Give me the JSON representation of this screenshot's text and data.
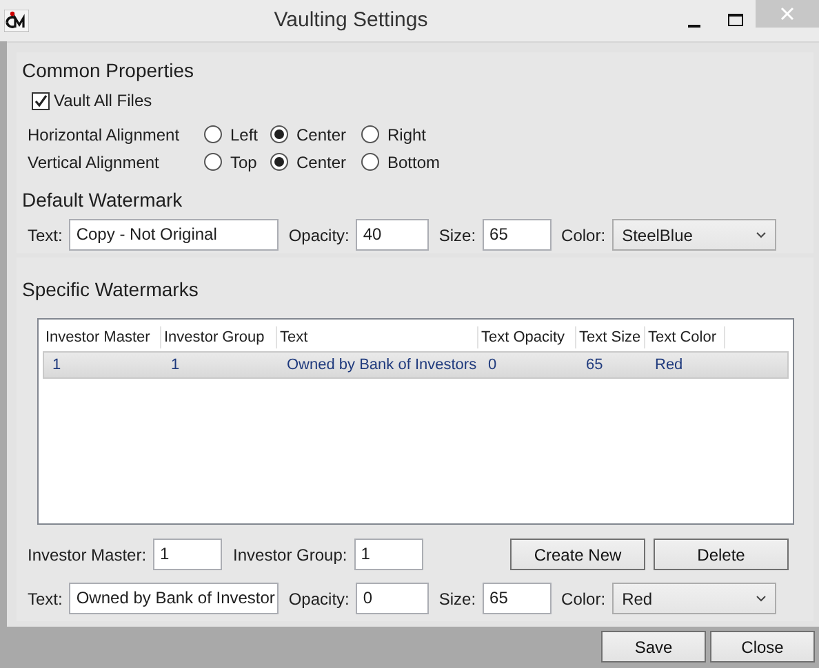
{
  "window": {
    "title": "Vaulting Settings"
  },
  "common": {
    "heading": "Common Properties",
    "vault_all": {
      "label": "Vault All Files",
      "checked": true
    },
    "alignments": [
      {
        "label": "Horizontal Alignment",
        "options": [
          {
            "label": "Left",
            "selected": false
          },
          {
            "label": "Center",
            "selected": true
          },
          {
            "label": "Right",
            "selected": false
          }
        ]
      },
      {
        "label": "Vertical Alignment",
        "options": [
          {
            "label": "Top",
            "selected": false
          },
          {
            "label": "Center",
            "selected": true
          },
          {
            "label": "Bottom",
            "selected": false
          }
        ]
      }
    ]
  },
  "default_watermark": {
    "heading": "Default Watermark",
    "fields": [
      {
        "kind": "input",
        "label": "Text:",
        "value": "Copy - Not Original"
      },
      {
        "kind": "input",
        "label": "Opacity:",
        "value": "40"
      },
      {
        "kind": "input",
        "label": "Size:",
        "value": "65"
      },
      {
        "kind": "select",
        "label": "Color:",
        "value": "SteelBlue"
      }
    ]
  },
  "specific": {
    "heading": "Specific Watermarks",
    "table": {
      "columns": [
        "Investor Master",
        "Investor Group",
        "Text",
        "Text Opacity",
        "Text Size",
        "Text Color"
      ],
      "rows": [
        {
          "cells": [
            "1",
            "1",
            "Owned by Bank of Investors",
            "0",
            "65",
            "Red"
          ],
          "selected": true
        }
      ]
    },
    "id_fields": [
      {
        "kind": "input",
        "label": "Investor Master:",
        "value": "1"
      },
      {
        "kind": "input",
        "label": "Investor Group:",
        "value": "1"
      }
    ],
    "actions": [
      "Create New",
      "Delete"
    ],
    "fields": [
      {
        "kind": "input",
        "label": "Text:",
        "value": "Owned by Bank of Investor"
      },
      {
        "kind": "input",
        "label": "Opacity:",
        "value": "0"
      },
      {
        "kind": "input",
        "label": "Size:",
        "value": "65"
      },
      {
        "kind": "select",
        "label": "Color:",
        "value": "Red"
      }
    ]
  },
  "buttons": [
    "Save",
    "Close"
  ]
}
